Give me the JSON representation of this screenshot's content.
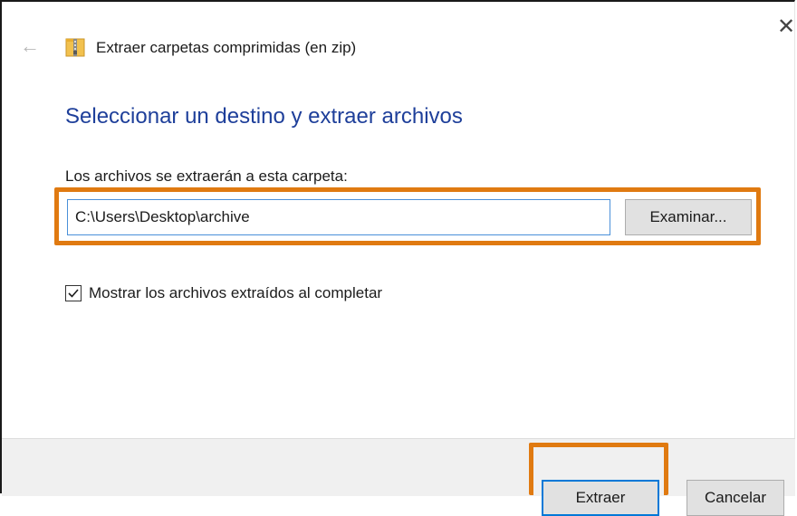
{
  "window": {
    "title": "Extraer carpetas comprimidas (en zip)",
    "back_icon": "arrow-left-icon",
    "close_icon": "close-icon",
    "app_icon": "zip-folder-icon"
  },
  "main": {
    "heading": "Seleccionar un destino y extraer archivos",
    "destination_label": "Los archivos se extraerán a esta carpeta:",
    "destination_value": "C:\\Users\\Desktop\\archive",
    "browse_label": "Examinar...",
    "show_files_checked": true,
    "show_files_label": "Mostrar los archivos extraídos al completar"
  },
  "footer": {
    "extract_label": "Extraer",
    "cancel_label": "Cancelar"
  },
  "colors": {
    "accent": "#1e3f9a",
    "highlight": "#e07a11",
    "focus": "#0078d7"
  }
}
